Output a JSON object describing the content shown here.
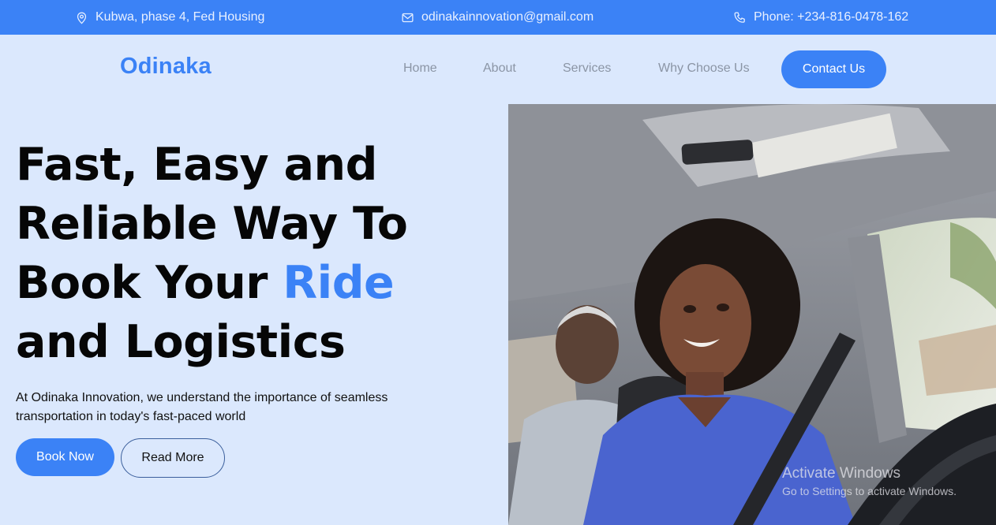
{
  "topbar": {
    "address": "Kubwa, phase 4, Fed Housing",
    "email": "odinakainnovation@gmail.com",
    "phone": "Phone: +234-816-0478-162"
  },
  "brand": {
    "logo": "Odinaka",
    "accent_color": "#3b82f6",
    "background": "#dbe8fd"
  },
  "nav": {
    "home": "Home",
    "about": "About",
    "services": "Services",
    "why": "Why Choose Us",
    "contact": "Contact Us"
  },
  "hero": {
    "title_part1": "Fast, Easy and Reliable Way To Book Your ",
    "title_accent": "Ride",
    "title_part2": " and Logistics",
    "description": "At Odinaka Innovation, we understand the importance of seamless transportation in today's fast-paced world",
    "book_label": "Book Now",
    "read_label": "Read More"
  },
  "watermark": {
    "line1": "Activate Windows",
    "line2": "Go to Settings to activate Windows."
  },
  "icons": {
    "address": "location-pin-icon",
    "email": "mail-icon",
    "phone": "phone-icon"
  }
}
